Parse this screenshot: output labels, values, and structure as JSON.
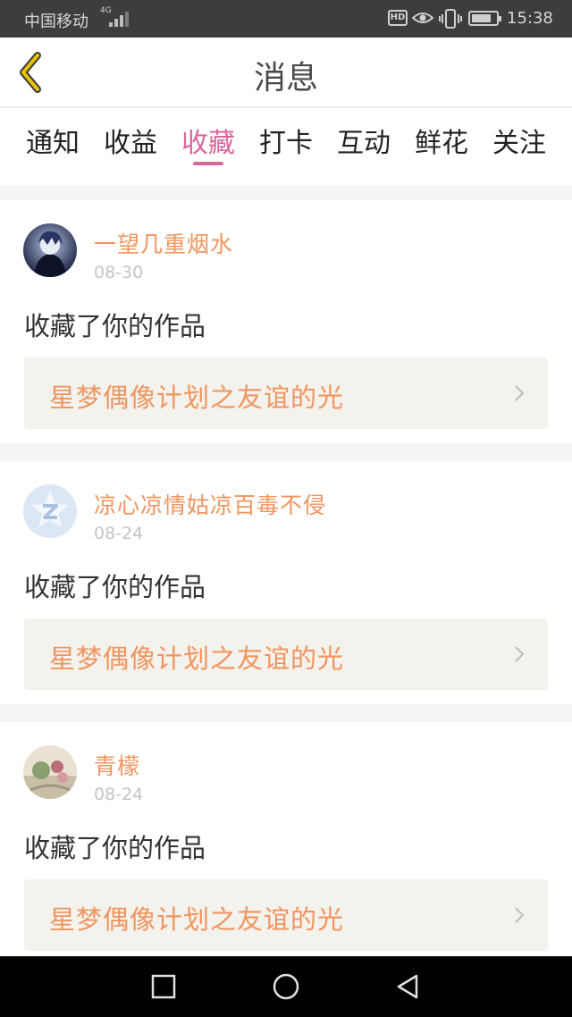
{
  "status_bar": {
    "carrier": "中国移动",
    "network": "4G",
    "hd_label": "HD",
    "time": "15:38",
    "battery_level": 0.8
  },
  "header": {
    "title": "消息",
    "back_icon": "chevron-left-icon",
    "accent_color": "#e8c400"
  },
  "tabs": [
    {
      "label": "通知",
      "active": false
    },
    {
      "label": "收益",
      "active": false
    },
    {
      "label": "收藏",
      "active": true
    },
    {
      "label": "打卡",
      "active": false
    },
    {
      "label": "互动",
      "active": false
    },
    {
      "label": "鲜花",
      "active": false
    },
    {
      "label": "关注",
      "active": false
    }
  ],
  "messages": [
    {
      "user": "一望几重烟水",
      "date": "08-30",
      "action": "收藏了你的作品",
      "work_title": "星梦偶像计划之友谊的光"
    },
    {
      "user": "凉心凉情姑凉百毒不侵",
      "date": "08-24",
      "action": "收藏了你的作品",
      "work_title": "星梦偶像计划之友谊的光"
    },
    {
      "user": "青檬",
      "date": "08-24",
      "action": "收藏了你的作品",
      "work_title": "星梦偶像计划之友谊的光"
    }
  ],
  "colors": {
    "active_tab": "#d9679c",
    "username": "#f0955f",
    "work_title": "#f0955f"
  },
  "nav_bar": {
    "recent_icon": "square-icon",
    "home_icon": "circle-icon",
    "back_icon": "triangle-back-icon"
  }
}
